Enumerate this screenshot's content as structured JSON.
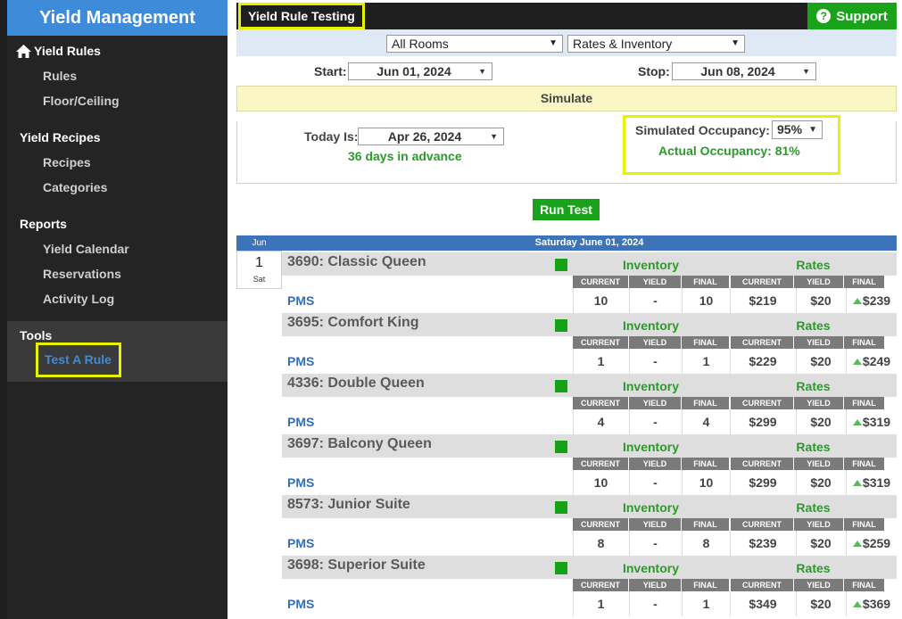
{
  "sidebar": {
    "app_title": "Yield Management",
    "sections": [
      {
        "title": "Yield Rules",
        "icon": "home-icon",
        "items": [
          "Rules",
          "Floor/Ceiling"
        ]
      },
      {
        "title": "Yield Recipes",
        "items": [
          "Recipes",
          "Categories"
        ]
      },
      {
        "title": "Reports",
        "items": [
          "Yield Calendar",
          "Reservations",
          "Activity Log"
        ]
      },
      {
        "title": "Tools",
        "items": [
          "Test A Rule"
        ]
      }
    ]
  },
  "header": {
    "page_title": "Yield Rule Testing",
    "support_label": "Support",
    "support_icon": "question-circle-icon"
  },
  "filters": {
    "rooms": "All Rooms",
    "mode": "Rates & Inventory",
    "start_label": "Start:",
    "start_date": "Jun 01, 2024",
    "stop_label": "Stop:",
    "stop_date": "Jun 08, 2024",
    "simulate_label": "Simulate"
  },
  "simulation": {
    "today_label": "Today Is:",
    "today_date": "Apr 26, 2024",
    "advance_text": "36 days in advance",
    "occupancy_label": "Simulated Occupancy:",
    "occupancy_value": "95%",
    "actual_occupancy": "Actual Occupancy: 81%",
    "run_label": "Run Test"
  },
  "calendar": {
    "month": "Jun",
    "day_number": "1",
    "day_of_week": "Sat",
    "day_header": "Saturday June 01, 2024"
  },
  "columns": {
    "inventory_title": "Inventory",
    "rates_title": "Rates",
    "current": "CURRENT",
    "yield": "YIELD",
    "final": "FINAL",
    "pms_label": "PMS"
  },
  "colors": {
    "accent_blue": "#3d8bd9",
    "highlight_yellow": "#e8f200",
    "status_green": "#15a215"
  },
  "rooms": [
    {
      "name": "3690: Classic Queen",
      "inv_current": "10",
      "inv_yield": "-",
      "inv_final": "10",
      "rate_current": "$219",
      "rate_yield": "$20",
      "rate_final": "$239"
    },
    {
      "name": "3695: Comfort King",
      "inv_current": "1",
      "inv_yield": "-",
      "inv_final": "1",
      "rate_current": "$229",
      "rate_yield": "$20",
      "rate_final": "$249"
    },
    {
      "name": "4336: Double Queen",
      "inv_current": "4",
      "inv_yield": "-",
      "inv_final": "4",
      "rate_current": "$299",
      "rate_yield": "$20",
      "rate_final": "$319"
    },
    {
      "name": "3697: Balcony Queen",
      "inv_current": "10",
      "inv_yield": "-",
      "inv_final": "10",
      "rate_current": "$299",
      "rate_yield": "$20",
      "rate_final": "$319"
    },
    {
      "name": "8573: Junior Suite",
      "inv_current": "8",
      "inv_yield": "-",
      "inv_final": "8",
      "rate_current": "$239",
      "rate_yield": "$20",
      "rate_final": "$259"
    },
    {
      "name": "3698: Superior Suite",
      "inv_current": "1",
      "inv_yield": "-",
      "inv_final": "1",
      "rate_current": "$349",
      "rate_yield": "$20",
      "rate_final": "$369"
    }
  ]
}
